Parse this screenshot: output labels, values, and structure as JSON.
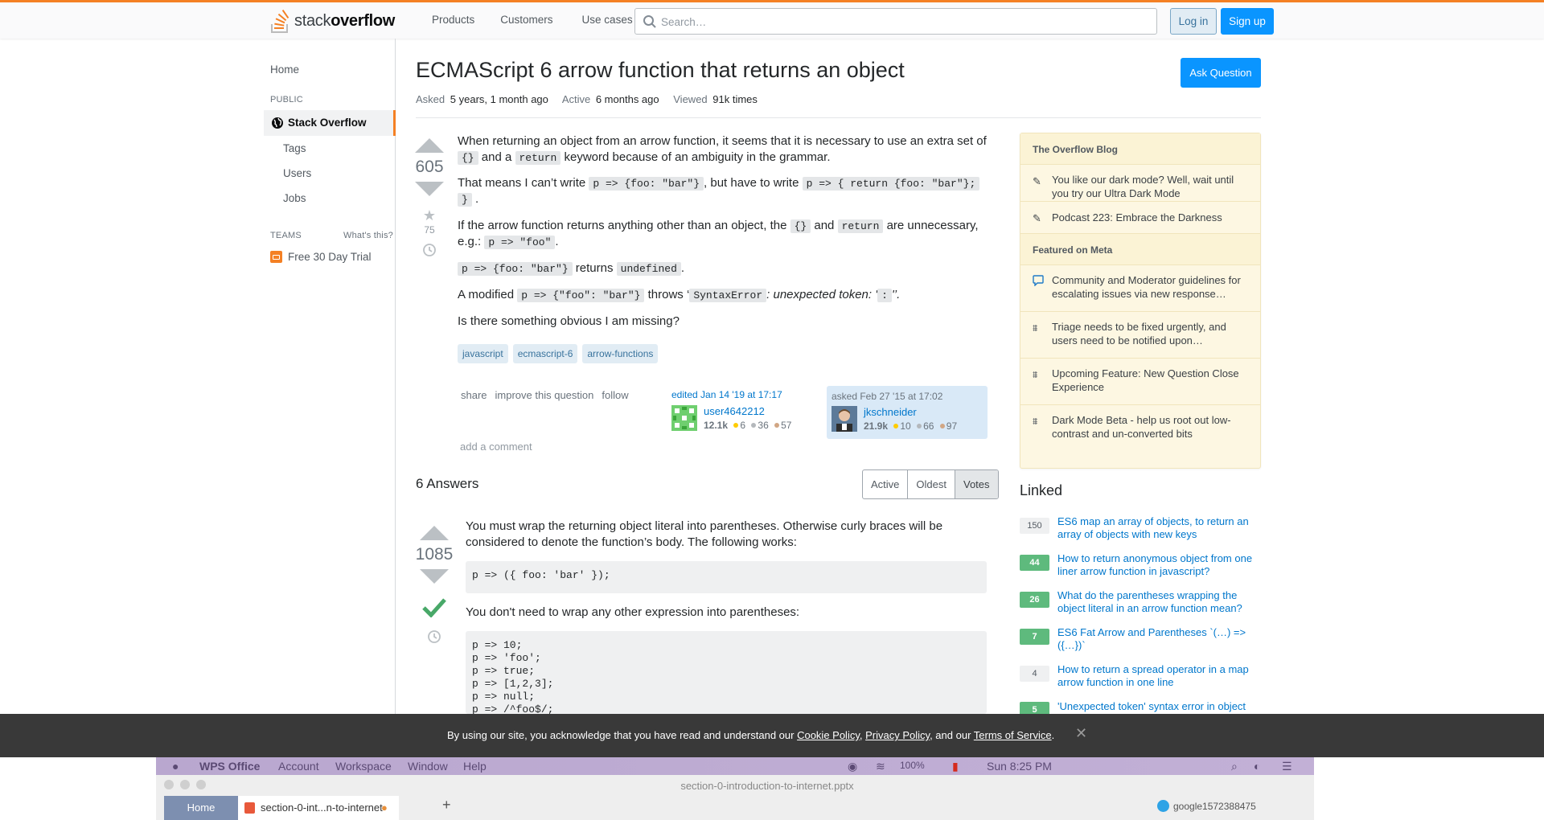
{
  "header": {
    "logo_light": "stack",
    "logo_bold": "overflow",
    "nav": [
      "Products",
      "Customers",
      "Use cases"
    ],
    "search_placeholder": "Search…",
    "login": "Log in",
    "signup": "Sign up"
  },
  "sidebar": {
    "home": "Home",
    "public_head": "PUBLIC",
    "stack_overflow": "Stack Overflow",
    "tags": "Tags",
    "users": "Users",
    "jobs": "Jobs",
    "teams_head": "TEAMS",
    "whats_this": "What's this?",
    "trial": "Free 30 Day Trial"
  },
  "question": {
    "title": "ECMAScript 6 arrow function that returns an object",
    "ask_button": "Ask Question",
    "asked_label": "Asked",
    "asked_value": "5 years, 1 month ago",
    "active_label": "Active",
    "active_value": "6 months ago",
    "viewed_label": "Viewed",
    "viewed_value": "91k times",
    "votes": "605",
    "favorites": "75",
    "p1a": "When returning an object from an arrow function, it seems that it is necessary to use an extra set of",
    "p1_code1": "{}",
    "p1b": "and a",
    "p1_code2": "return",
    "p1c": "keyword because of an ambiguity in the grammar.",
    "p2a": "That means I can’t write",
    "p2_code1": "p => {foo: \"bar\"}",
    "p2b": ", but have to write",
    "p2_code2": "p => { return {foo: \"bar\"};",
    "p2_code3": "}",
    "p2c": ".",
    "p3a": "If the arrow function returns anything other than an object, the",
    "p3_code1": "{}",
    "p3b": "and",
    "p3_code2": "return",
    "p3c": "are unnecessary,",
    "p3d": "e.g.:",
    "p3_code3": "p => \"foo\"",
    "p3e": ".",
    "p4_code1": "p => {foo: \"bar\"}",
    "p4a": "returns",
    "p4_code2": "undefined",
    "p4b": ".",
    "p5a": "A modified",
    "p5_code1": "p => {\"foo\": \"bar\"}",
    "p5b": "throws ‘",
    "p5_code2": "SyntaxError",
    "p5c": ": unexpected token: '",
    "p5_code3": ":",
    "p5d": "'’.",
    "p6": "Is there something obvious I am missing?",
    "tags": [
      "javascript",
      "ecmascript-6",
      "arrow-functions"
    ],
    "menu": [
      "share",
      "improve this question",
      "follow"
    ],
    "edited_action": "edited Jan 14 '19 at 17:17",
    "editor_name": "user4642212",
    "editor_rep": "12.1k",
    "editor_gold": "6",
    "editor_silver": "36",
    "editor_bronze": "57",
    "asked_action": "asked Feb 27 '15 at 17:02",
    "asker_name": "jkschneider",
    "asker_rep": "21.9k",
    "asker_gold": "10",
    "asker_silver": "66",
    "asker_bronze": "97",
    "add_comment": "add a comment"
  },
  "answers": {
    "header": "6 Answers",
    "sort_tabs": [
      "Active",
      "Oldest",
      "Votes"
    ],
    "votes": "1085",
    "p1": "You must wrap the returning object literal into parentheses. Otherwise curly braces will be considered to denote the function’s body. The following works:",
    "code1": "p => ({ foo: 'bar' });",
    "p2": "You don't need to wrap any other expression into parentheses:",
    "code2": [
      "p => 10;",
      "p => 'foo';",
      "p => true;",
      "p => [1,2,3];",
      "p => null;",
      "p => /^foo$/;"
    ]
  },
  "right": {
    "blog_head": "The Overflow Blog",
    "blog_items": [
      "You like our dark mode? Well, wait until you try our Ultra Dark Mode",
      "Podcast 223: Embrace the Darkness"
    ],
    "meta_head": "Featured on Meta",
    "meta_items": [
      "Community and Moderator guidelines for escalating issues via new response…",
      "Triage needs to be fixed urgently, and users need to be notified upon…",
      "Upcoming Feature: New Question Close Experience",
      "Dark Mode Beta - help us root out low-contrast and un-converted bits"
    ],
    "linked_head": "Linked",
    "linked": [
      {
        "score": "150",
        "title": "ES6 map an array of objects, to return an array of objects with new keys",
        "accepted": false
      },
      {
        "score": "44",
        "title": "How to return anonymous object from one liner arrow function in javascript?",
        "accepted": true
      },
      {
        "score": "26",
        "title": "What do the parentheses wrapping the object literal in an arrow function mean?",
        "accepted": true
      },
      {
        "score": "7",
        "title": "ES6 Fat Arrow and Parentheses `(…) => ({…})`",
        "accepted": true
      },
      {
        "score": "4",
        "title": "How to return a spread operator in a map arrow function in one line",
        "accepted": false
      },
      {
        "score": "5",
        "title": "'Unexpected token' syntax error in object",
        "accepted": true
      }
    ]
  },
  "cookie": {
    "pre": "By using our site, you acknowledge that you have read and understand our",
    "cookie_policy": "Cookie Policy",
    "comma": ",",
    "privacy_policy": "Privacy Policy",
    "and": ", and our",
    "terms": "Terms of Service",
    "end": "."
  },
  "mac_menu": {
    "app": "WPS Office",
    "items": [
      "Account",
      "Workspace",
      "Window",
      "Help"
    ],
    "battery": "100%",
    "clock": "Sun 8:25 PM"
  },
  "wps": {
    "file_title": "section-0-introduction-to-internet.pptx",
    "home_tab": "Home",
    "doc_tab": "section-0-int...n-to-internet",
    "user": "google1572388475"
  },
  "colors": {
    "accent": "#f48024",
    "link": "#0077cc",
    "primary_button": "#0a95ff",
    "accepted": "#5eba7d"
  }
}
